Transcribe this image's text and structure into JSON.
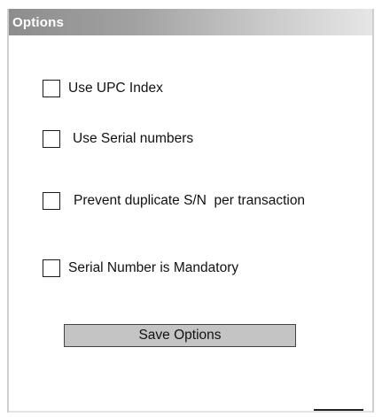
{
  "panel": {
    "title": "Options"
  },
  "options": [
    {
      "label": "Use UPC Index",
      "checked": false
    },
    {
      "label": "Use Serial numbers",
      "checked": false
    },
    {
      "label": "Prevent duplicate S/N  per transaction",
      "checked": false
    },
    {
      "label": "Serial Number is Mandatory",
      "checked": false
    }
  ],
  "save_button": {
    "label": "Save Options"
  },
  "colors": {
    "title_gradient_start": "#8d8d8d",
    "title_gradient_end": "#e6e6e6",
    "title_text": "#ffffff",
    "button_face": "#c4c4c4"
  }
}
